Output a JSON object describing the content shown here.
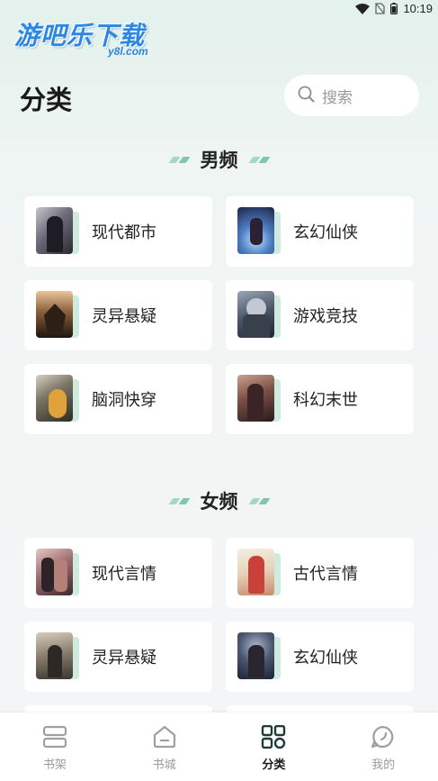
{
  "status_bar": {
    "time": "10:19"
  },
  "logo": {
    "main": "游吧乐下载",
    "sub": "y8l.com"
  },
  "header": {
    "title": "分类"
  },
  "search": {
    "placeholder": "搜索"
  },
  "sections": [
    {
      "title": "男频",
      "items": [
        {
          "label": "现代都市",
          "cover": "cover-modern-city"
        },
        {
          "label": "玄幻仙侠",
          "cover": "cover-fantasy-immortal"
        },
        {
          "label": "灵异悬疑",
          "cover": "cover-supernatural"
        },
        {
          "label": "游戏竞技",
          "cover": "cover-gaming"
        },
        {
          "label": "脑洞快穿",
          "cover": "cover-brainhole"
        },
        {
          "label": "科幻末世",
          "cover": "cover-scifi"
        }
      ]
    },
    {
      "title": "女频",
      "items": [
        {
          "label": "现代言情",
          "cover": "cover-modern-romance"
        },
        {
          "label": "古代言情",
          "cover": "cover-ancient-romance"
        },
        {
          "label": "灵异悬疑",
          "cover": "cover-supernatural-f"
        },
        {
          "label": "玄幻仙侠",
          "cover": "cover-fantasy-f"
        }
      ]
    }
  ],
  "tabs": [
    {
      "label": "书架",
      "icon": "bookshelf-icon",
      "active": false
    },
    {
      "label": "书城",
      "icon": "bookstore-icon",
      "active": false
    },
    {
      "label": "分类",
      "icon": "category-icon",
      "active": true
    },
    {
      "label": "我的",
      "icon": "profile-icon",
      "active": false
    }
  ],
  "colors": {
    "accent": "#7cc8a8",
    "logo": "#2d86e0",
    "active_tab": "#1a1a1a",
    "inactive_tab": "#9a9a9a"
  }
}
